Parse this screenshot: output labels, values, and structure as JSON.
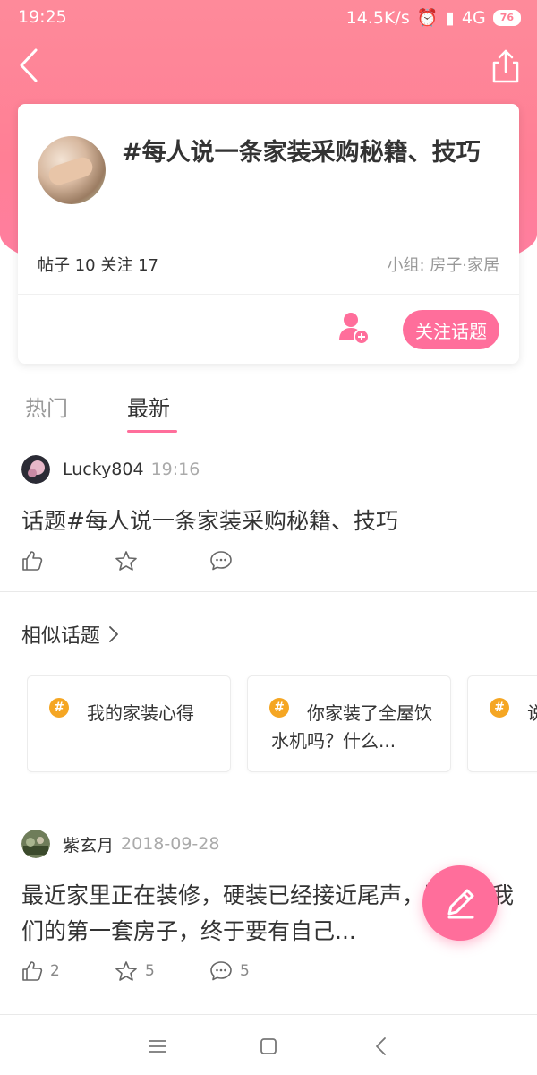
{
  "status": {
    "time": "19:25",
    "speed": "14.5K/s",
    "network": "4G",
    "battery": "76"
  },
  "topic": {
    "title": "#每人说一条家装采购秘籍、技巧",
    "stats": "帖子 10  关注 17",
    "group": "小组: 房子·家居",
    "follow_label": "关注话题"
  },
  "tabs": [
    {
      "label": "热门"
    },
    {
      "label": "最新"
    }
  ],
  "posts": [
    {
      "user": "Lucky804",
      "time": "19:16",
      "text": "话题#每人说一条家装采购秘籍、技巧",
      "likes": "",
      "favorites": "",
      "comments": ""
    },
    {
      "user": "紫玄月",
      "time": "2018-09-28",
      "text": "最近家里正在装修，硬装已经接近尾声，因为是我们的第一套房子，终于要有自己...",
      "likes": "2",
      "favorites": "5",
      "comments": "5"
    }
  ],
  "similar": {
    "title": "相似话题",
    "items": [
      {
        "text": "我的家装心得"
      },
      {
        "text": "你家装了全屋饮水机吗？什么..."
      },
      {
        "text": "说说遗留了..."
      }
    ]
  },
  "colors": {
    "accent": "#ff6e9b",
    "header_top": "#fe8a9a",
    "header_bottom": "#ff7ea2",
    "badge": "#f5a623"
  }
}
